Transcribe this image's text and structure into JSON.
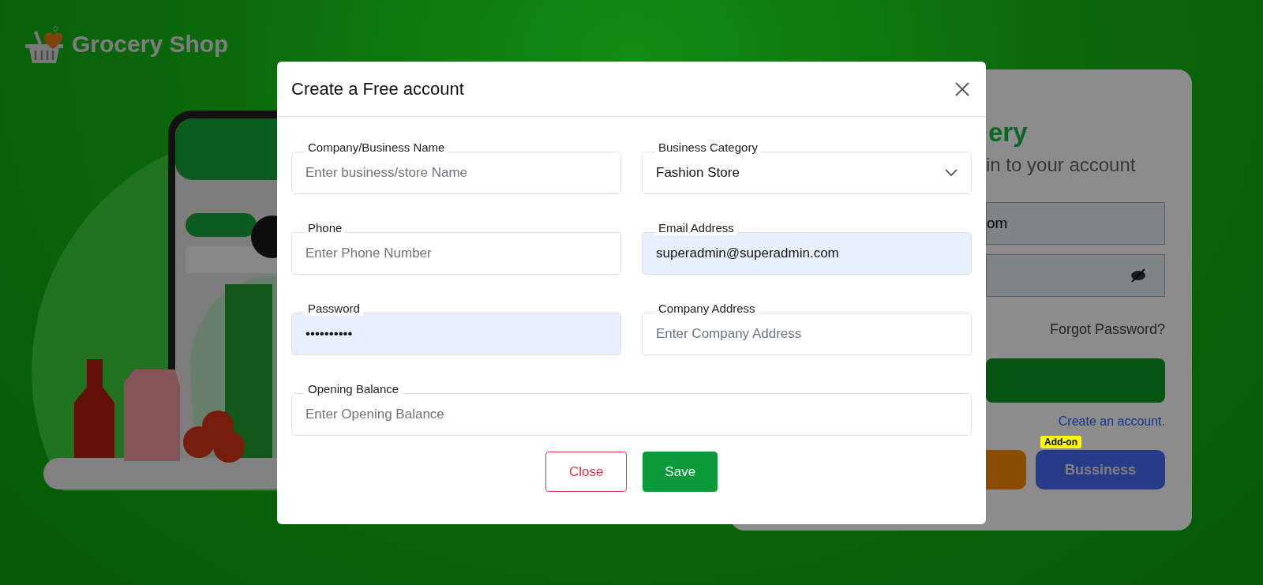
{
  "brand": {
    "name": "Grocery Shop"
  },
  "login_card": {
    "heading": "ery",
    "subtitle": "in to your account",
    "email_value": "om",
    "forgot_link": "Forgot Password?",
    "create_link": "Create an account.",
    "business_button": {
      "label": "Bussiness",
      "badge": "Add-on"
    }
  },
  "modal": {
    "title": "Create a Free account",
    "fields": [
      {
        "kind": "text",
        "label": "Company/Business Name",
        "placeholder": "Enter business/store Name",
        "autofilled": false
      },
      {
        "kind": "select",
        "label": "Business Category",
        "value": "Fashion Store"
      },
      {
        "kind": "text",
        "label": "Phone",
        "placeholder": "Enter Phone Number",
        "autofilled": false
      },
      {
        "kind": "text",
        "label": "Email Address",
        "value": "superadmin@superadmin.com",
        "autofilled": true
      },
      {
        "kind": "text",
        "label": "Password",
        "value": "••••••••••",
        "autofilled": true
      },
      {
        "kind": "text",
        "label": "Company Address",
        "placeholder": "Enter Company Address",
        "autofilled": false
      },
      {
        "kind": "text",
        "label": "Opening Balance",
        "placeholder": "Enter Opening Balance",
        "autofilled": false
      }
    ],
    "buttons": [
      {
        "kind": "outline",
        "label": "Close"
      },
      {
        "kind": "primary",
        "label": "Save"
      }
    ]
  }
}
